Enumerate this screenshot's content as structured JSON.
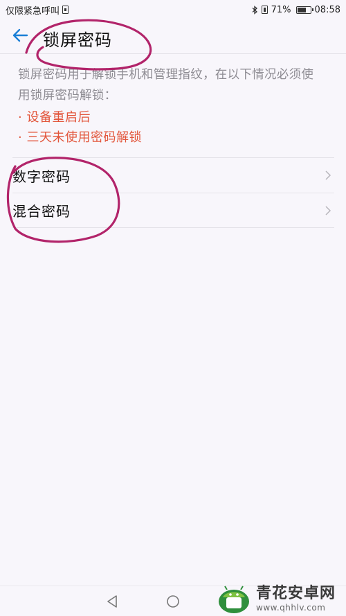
{
  "status_bar": {
    "carrier_text": "仅限紧急呼叫",
    "battery_percent": "71%",
    "battery_level": 0.71,
    "time": "08:58"
  },
  "header": {
    "title": "锁屏密码",
    "back_icon": "back-arrow-icon"
  },
  "description": {
    "line1": "锁屏密码用于解锁手机和管理指纹，在以下情况必须使",
    "line2": "用锁屏密码解锁：",
    "conditions": [
      "· 设备重启后",
      "· 三天未使用密码解锁"
    ],
    "condition_color": "#e2553b"
  },
  "options": [
    {
      "label": "数字密码"
    },
    {
      "label": "混合密码"
    }
  ],
  "navbar": {
    "back_icon": "triangle-back-icon",
    "home_icon": "circle-home-icon"
  },
  "watermark": {
    "name": "青花安卓网",
    "url": "www.qhhlv.com"
  },
  "colors": {
    "accent": "#1b7fd6",
    "annotation": "#b2246a"
  }
}
